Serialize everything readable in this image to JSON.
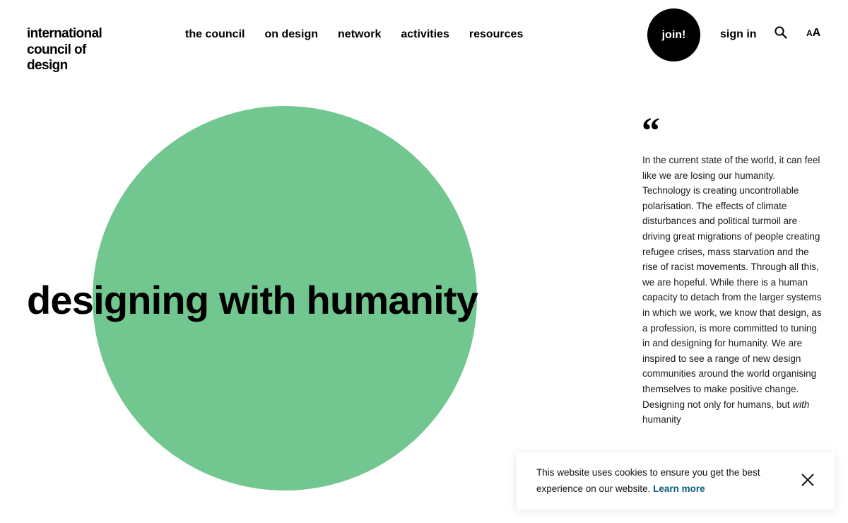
{
  "header": {
    "logo_lines": [
      "international",
      "council of",
      "design"
    ],
    "nav": [
      {
        "label": "the council"
      },
      {
        "label": "on design"
      },
      {
        "label": "network"
      },
      {
        "label": "activities"
      },
      {
        "label": "resources"
      }
    ],
    "join_label": "join!",
    "signin_label": "sign in",
    "search_icon": "search-icon",
    "text_size_small": "A",
    "text_size_large": "A"
  },
  "hero": {
    "title": "designing with humanity",
    "circle_color": "#72c68f"
  },
  "quote": {
    "mark": "“",
    "text_before": "In the current state of the world, it can feel like we are losing our humanity. Technology is creating uncontrollable polarisation. The effects of climate disturbances and political turmoil are driving great migrations of people creating refugee crises, mass starvation and the rise of racist movements. Through all this, we are hopeful. While there is a human capacity to detach from the larger systems in which we work, we know that design, as a profession, is more committed to tuning in and designing for humanity. We are inspired to see a range of new design communities around the world organising themselves to make positive change. Designing not only for humans, but",
    "emphasis": "with",
    "text_after": "humanity"
  },
  "cookie": {
    "message": "This website uses cookies to ensure you get the best experience on our website.",
    "link_label": "Learn more",
    "close_icon": "close-icon",
    "link_color": "#0d5b7d"
  }
}
